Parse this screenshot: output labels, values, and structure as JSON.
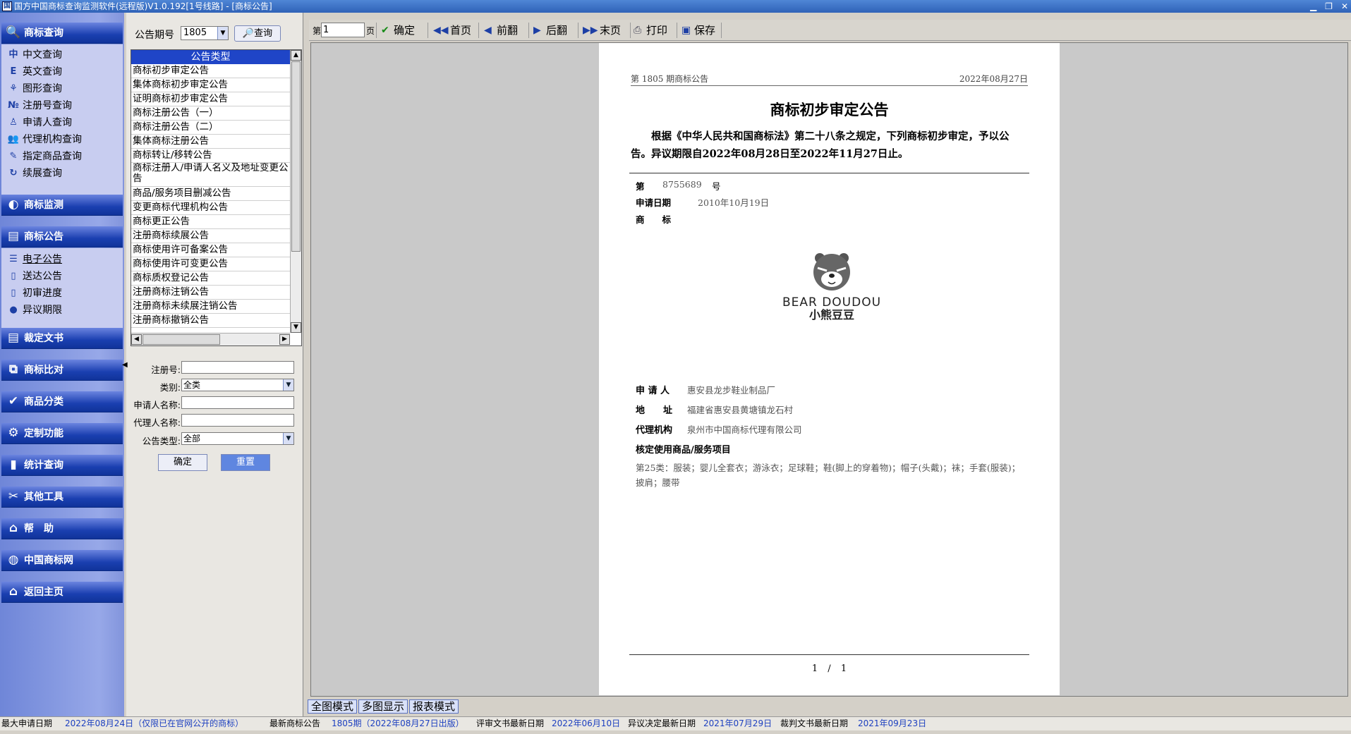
{
  "window": {
    "title": "国方中国商标查询监测软件(远程版)V1.0.192[1号线路] - [商标公告]"
  },
  "nav": {
    "g1": "商标查询",
    "g1_items": [
      "中文查询",
      "英文查询",
      "图形查询",
      "注册号查询",
      "申请人查询",
      "代理机构查询",
      "指定商品查询",
      "续展查询"
    ],
    "g2": "商标监测",
    "g3": "商标公告",
    "g3_items": [
      "电子公告",
      "送达公告",
      "初审进度",
      "异议期限"
    ],
    "g4": "裁定文书",
    "g5": "商标比对",
    "g6": "商品分类",
    "g7": "定制功能",
    "g8": "统计查询",
    "g9": "其他工具",
    "g10": "帮　助",
    "g11": "中国商标网",
    "g12": "返回主页"
  },
  "filter": {
    "issue_label": "公告期号",
    "issue_value": "1805",
    "query_button": "查询",
    "list_header": "公告类型",
    "list_items": [
      "商标初步审定公告",
      "集体商标初步审定公告",
      "证明商标初步审定公告",
      "商标注册公告（一）",
      "商标注册公告（二）",
      "集体商标注册公告",
      "商标转让/移转公告",
      "商标注册人/申请人名义及地址变更公告",
      "商品/服务项目删减公告",
      "变更商标代理机构公告",
      "商标更正公告",
      "注册商标续展公告",
      "商标使用许可备案公告",
      "商标使用许可变更公告",
      "商标质权登记公告",
      "注册商标注销公告",
      "注册商标未续展注销公告",
      "注册商标撤销公告"
    ],
    "reg_no_label": "注册号:",
    "class_label": "类别:",
    "class_value": "全类",
    "applicant_label": "申请人名称:",
    "agent_label": "代理人名称:",
    "type_label": "公告类型:",
    "type_value": "全部",
    "ok_button": "确定",
    "reset_button": "重置"
  },
  "toolbar": {
    "page_prefix": "第",
    "page_value": "1",
    "page_suffix": "页",
    "confirm": "确定",
    "first": "首页",
    "prev": "前翻",
    "next": "后翻",
    "last": "末页",
    "print": "打印",
    "save": "保存"
  },
  "document": {
    "issue": "第 1805 期商标公告",
    "date": "2022年08月27日",
    "title": "商标初步审定公告",
    "intro": "根据《中华人民共和国商标法》第二十八条之规定，下列商标初步审定，予以公告。异议期限自2022年08月28日至2022年11月27日止。",
    "no_label": "第",
    "no_value": "8755689",
    "no_suffix": "号",
    "apply_date_label": "申请日期",
    "apply_date": "2010年10月19日",
    "mark_label": "商　　标",
    "logo_en": "BEAR DOUDOU",
    "logo_cn": "小熊豆豆",
    "applicant_label": "申 请 人",
    "applicant": "惠安县龙步鞋业制品厂",
    "address_label": "地　　址",
    "address": "福建省惠安县黄塘镇龙石村",
    "agent_label": "代理机构",
    "agent": "泉州市中国商标代理有限公司",
    "goods_label": "核定使用商品/服务项目",
    "goods": "第25类：服装；婴儿全套衣；游泳衣；足球鞋；鞋(脚上的穿着物)；帽子(头戴)；袜；手套(服装)；披肩；腰带",
    "page_cur": "1",
    "page_sep": "/",
    "page_total": "1"
  },
  "tabs": [
    "全图模式",
    "多图显示",
    "报表模式"
  ],
  "status": {
    "l1": "最大申请日期",
    "v1": "2022年08月24日（仅限已在官网公开的商标）",
    "l2": "最新商标公告",
    "v2": "1805期（2022年08月27日出版）",
    "l3": "评审文书最新日期",
    "v3": "2022年06月10日",
    "l4": "异议决定最新日期",
    "v4": "2021年07月29日",
    "l5": "裁判文书最新日期",
    "v5": "2021年09月23日"
  },
  "colors": {
    "nav_group": "#1a3fb0",
    "list_header": "#1f45c7",
    "status_value": "#1c3fc0"
  }
}
